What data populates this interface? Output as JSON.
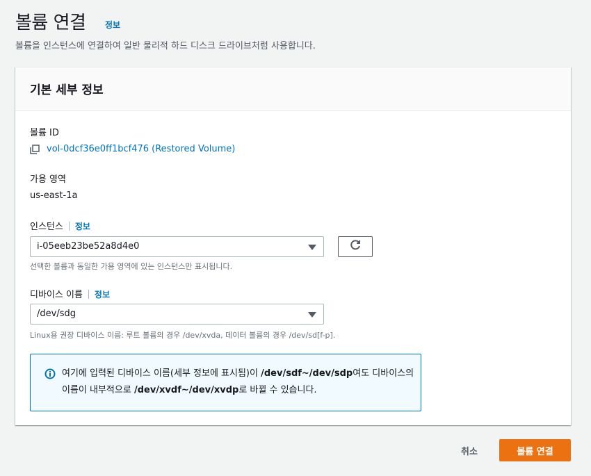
{
  "page": {
    "title": "볼륨 연결",
    "info_link": "정보",
    "description": "볼륨을 인스턴스에 연결하여 일반 물리적 하드 디스크 드라이브처럼 사용합니다."
  },
  "panel": {
    "title": "기본 세부 정보",
    "volume_id_label": "볼륨 ID",
    "volume_id_value": "vol-0dcf36e0ff1bcf476 (Restored Volume)",
    "az_label": "가용 영역",
    "az_value": "us-east-1a",
    "instance_label": "인스턴스",
    "instance_info": "정보",
    "instance_selected": "i-05eeb23be52a8d4e0",
    "instance_hint": "선택한 볼륨과 동일한 가용 영역에 있는 인스턴스만 표시됩니다.",
    "device_label": "디바이스 이름",
    "device_info": "정보",
    "device_selected": "/dev/sdg",
    "device_hint": "Linux용 권장 디바이스 이름: 루트 볼륨의 경우 /dev/xvda, 데이터 볼륨의 경우 /dev/sd[f-p]."
  },
  "alert": {
    "part1": "여기에 입력된 디바이스 이름(세부 정보에 표시됨)이 ",
    "bold1": "/dev/sdf~/dev/sdp",
    "part2": "여도 디바이스의 이름이 내부적으로 ",
    "bold2": "/dev/xvdf~/dev/xvdp",
    "part3": "로 바뀔 수 있습니다."
  },
  "footer": {
    "cancel_label": "취소",
    "submit_label": "볼륨 연결"
  },
  "colors": {
    "accent": "#ec7211",
    "link": "#0073bb",
    "alert_bg": "#f1faff"
  },
  "icons": [
    "copy-icon",
    "refresh-icon",
    "info-icon",
    "caret-down-icon"
  ]
}
